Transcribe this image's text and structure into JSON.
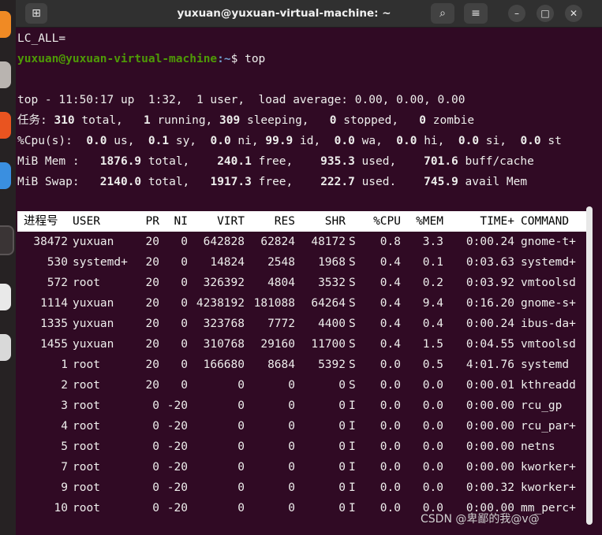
{
  "window": {
    "title": "yuxuan@yuxuan-virtual-machine: ~",
    "newtab_icon": "⊞",
    "search_icon": "⌕",
    "menu_icon": "≡",
    "minimize_icon": "–",
    "maximize_icon": "□",
    "close_icon": "✕"
  },
  "terminal": {
    "line_lcall": "LC_ALL=",
    "prompt_user": "yuxuan@yuxuan-virtual-machine",
    "prompt_path": ":~",
    "prompt_cmd": "$ top",
    "summary": {
      "top_line": "top - 11:50:17 up  1:32,  1 user,  load average: 0.00, 0.00, 0.00",
      "tasks": {
        "label": "任务:",
        "total": "310",
        "total_label": " total,",
        "running": "1",
        "running_label": " running,",
        "sleeping": "309",
        "sleeping_label": " sleeping,",
        "stopped": "0",
        "stopped_label": " stopped,",
        "zombie": "0",
        "zombie_label": " zombie"
      },
      "cpu": {
        "label": "%Cpu(s):",
        "us": "0.0",
        "us_l": " us,",
        "sy": "0.1",
        "sy_l": " sy,",
        "ni": "0.0",
        "ni_l": " ni,",
        "id": "99.9",
        "id_l": " id,",
        "wa": "0.0",
        "wa_l": " wa,",
        "hi": "0.0",
        "hi_l": " hi,",
        "si": "0.0",
        "si_l": " si,",
        "st": "0.0",
        "st_l": " st"
      },
      "mem": {
        "label": "MiB Mem :",
        "total": "1876.9",
        "total_l": " total,",
        "free": "240.1",
        "free_l": " free,",
        "used": "935.3",
        "used_l": " used,",
        "cache": "701.6",
        "cache_l": " buff/cache"
      },
      "swap": {
        "label": "MiB Swap:",
        "total": "2140.0",
        "total_l": " total,",
        "free": "1917.3",
        "free_l": " free,",
        "used": "222.7",
        "used_l": " used.",
        "avail": "745.9",
        "avail_l": " avail Mem"
      }
    },
    "columns": {
      "pid": "进程号",
      "user": "USER",
      "pr": "PR",
      "ni": "NI",
      "virt": "VIRT",
      "res": "RES",
      "shr": "SHR",
      "s": "",
      "cpu": "%CPU",
      "mem": "%MEM",
      "time": "TIME+",
      "cmd": "COMMAND"
    },
    "processes": [
      {
        "pid": "38472",
        "user": "yuxuan",
        "pr": "20",
        "ni": "0",
        "virt": "642828",
        "res": "62824",
        "shr": "48172",
        "s": "S",
        "cpu": "0.8",
        "mem": "3.3",
        "time": "0:00.24",
        "cmd": "gnome-t+"
      },
      {
        "pid": "530",
        "user": "systemd+",
        "pr": "20",
        "ni": "0",
        "virt": "14824",
        "res": "2548",
        "shr": "1968",
        "s": "S",
        "cpu": "0.4",
        "mem": "0.1",
        "time": "0:03.63",
        "cmd": "systemd+"
      },
      {
        "pid": "572",
        "user": "root",
        "pr": "20",
        "ni": "0",
        "virt": "326392",
        "res": "4804",
        "shr": "3532",
        "s": "S",
        "cpu": "0.4",
        "mem": "0.2",
        "time": "0:03.92",
        "cmd": "vmtoolsd"
      },
      {
        "pid": "1114",
        "user": "yuxuan",
        "pr": "20",
        "ni": "0",
        "virt": "4238192",
        "res": "181088",
        "shr": "64264",
        "s": "S",
        "cpu": "0.4",
        "mem": "9.4",
        "time": "0:16.20",
        "cmd": "gnome-s+"
      },
      {
        "pid": "1335",
        "user": "yuxuan",
        "pr": "20",
        "ni": "0",
        "virt": "323768",
        "res": "7772",
        "shr": "4400",
        "s": "S",
        "cpu": "0.4",
        "mem": "0.4",
        "time": "0:00.24",
        "cmd": "ibus-da+"
      },
      {
        "pid": "1455",
        "user": "yuxuan",
        "pr": "20",
        "ni": "0",
        "virt": "310768",
        "res": "29160",
        "shr": "11700",
        "s": "S",
        "cpu": "0.4",
        "mem": "1.5",
        "time": "0:04.55",
        "cmd": "vmtoolsd"
      },
      {
        "pid": "1",
        "user": "root",
        "pr": "20",
        "ni": "0",
        "virt": "166680",
        "res": "8684",
        "shr": "5392",
        "s": "S",
        "cpu": "0.0",
        "mem": "0.5",
        "time": "4:01.76",
        "cmd": "systemd"
      },
      {
        "pid": "2",
        "user": "root",
        "pr": "20",
        "ni": "0",
        "virt": "0",
        "res": "0",
        "shr": "0",
        "s": "S",
        "cpu": "0.0",
        "mem": "0.0",
        "time": "0:00.01",
        "cmd": "kthreadd"
      },
      {
        "pid": "3",
        "user": "root",
        "pr": "0",
        "ni": "-20",
        "virt": "0",
        "res": "0",
        "shr": "0",
        "s": "I",
        "cpu": "0.0",
        "mem": "0.0",
        "time": "0:00.00",
        "cmd": "rcu_gp"
      },
      {
        "pid": "4",
        "user": "root",
        "pr": "0",
        "ni": "-20",
        "virt": "0",
        "res": "0",
        "shr": "0",
        "s": "I",
        "cpu": "0.0",
        "mem": "0.0",
        "time": "0:00.00",
        "cmd": "rcu_par+"
      },
      {
        "pid": "5",
        "user": "root",
        "pr": "0",
        "ni": "-20",
        "virt": "0",
        "res": "0",
        "shr": "0",
        "s": "I",
        "cpu": "0.0",
        "mem": "0.0",
        "time": "0:00.00",
        "cmd": "netns"
      },
      {
        "pid": "7",
        "user": "root",
        "pr": "0",
        "ni": "-20",
        "virt": "0",
        "res": "0",
        "shr": "0",
        "s": "I",
        "cpu": "0.0",
        "mem": "0.0",
        "time": "0:00.00",
        "cmd": "kworker+"
      },
      {
        "pid": "9",
        "user": "root",
        "pr": "0",
        "ni": "-20",
        "virt": "0",
        "res": "0",
        "shr": "0",
        "s": "I",
        "cpu": "0.0",
        "mem": "0.0",
        "time": "0:00.32",
        "cmd": "kworker+"
      },
      {
        "pid": "10",
        "user": "root",
        "pr": "0",
        "ni": "-20",
        "virt": "0",
        "res": "0",
        "shr": "0",
        "s": "I",
        "cpu": "0.0",
        "mem": "0.0",
        "time": "0:00.00",
        "cmd": "mm_perc+"
      }
    ]
  },
  "watermark": "CSDN @卑鄙的我@v@"
}
